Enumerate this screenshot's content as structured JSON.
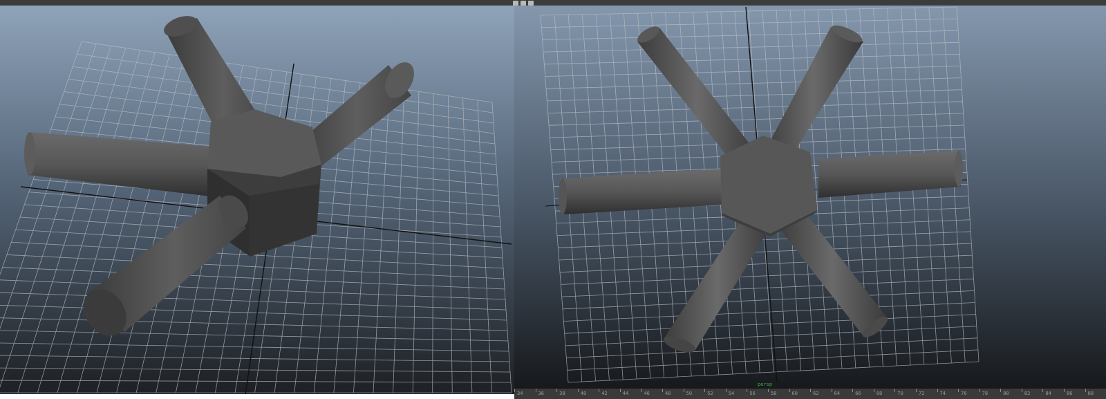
{
  "app": {
    "name": "3D viewport",
    "toolbar_icons": [
      "viewport-tool-icon",
      "snapshot-icon",
      "render-icon"
    ]
  },
  "viewports": {
    "left": {
      "view": "perspective",
      "object": "hexagonal hub with five cylinders"
    },
    "right": {
      "view": "top",
      "object": "hexagonal hub with six cylinders",
      "camera_label": "persp"
    }
  },
  "timeline": {
    "ticks": [
      "34",
      "36",
      "38",
      "40",
      "42",
      "44",
      "46",
      "48",
      "50",
      "52",
      "54",
      "56",
      "58",
      "60",
      "62",
      "64",
      "66",
      "68",
      "70",
      "72",
      "74",
      "76",
      "78",
      "80",
      "82",
      "84",
      "86",
      "88"
    ]
  },
  "colors": {
    "viewport_top": "#8a9fb6",
    "viewport_bottom": "#1f2226",
    "grid": "#b8bcc2",
    "mesh_light": "#5a5a5a",
    "mesh_dark": "#333333"
  }
}
